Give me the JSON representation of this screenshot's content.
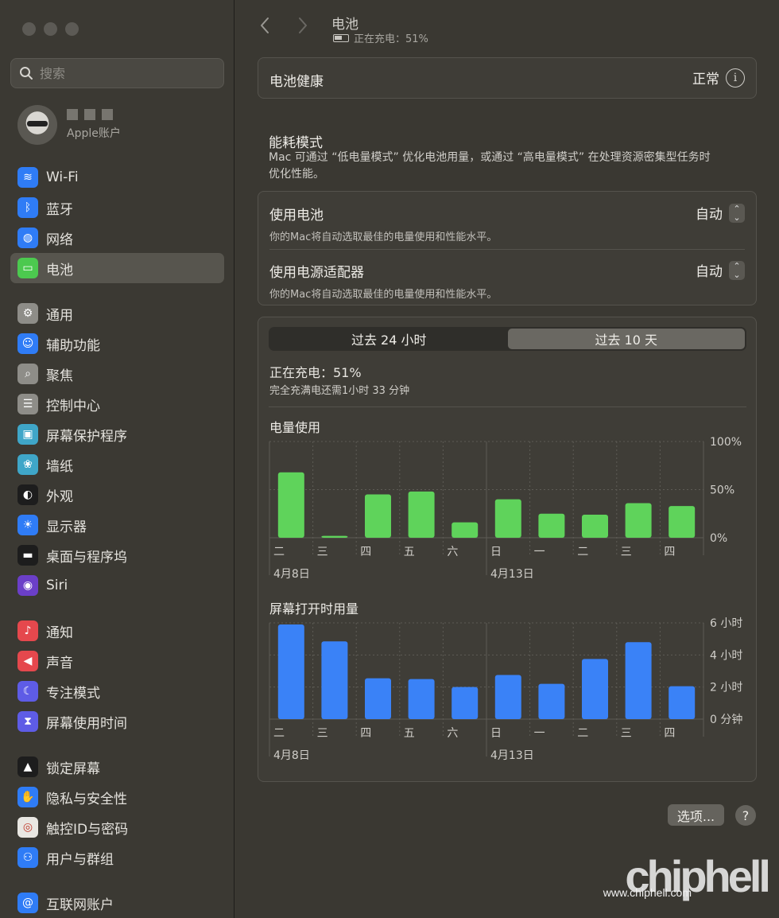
{
  "sidebar": {
    "search_placeholder": "搜索",
    "account": {
      "subtitle": "Apple账户"
    },
    "groups": [
      [
        {
          "label": "Wi-Fi",
          "icon": "wifi-icon",
          "color": "#2f7cf6",
          "glyph": "≋"
        },
        {
          "label": "蓝牙",
          "icon": "bluetooth-icon",
          "color": "#2f7cf6",
          "glyph": "ᛒ"
        },
        {
          "label": "网络",
          "icon": "globe-icon",
          "color": "#2f7cf6",
          "glyph": "◍"
        },
        {
          "label": "电池",
          "icon": "battery-icon",
          "color": "#4cc94f",
          "glyph": "▭",
          "active": true
        }
      ],
      [
        {
          "label": "通用",
          "icon": "gear-icon",
          "color": "#8e8d88",
          "glyph": "⚙"
        },
        {
          "label": "辅助功能",
          "icon": "accessibility-icon",
          "color": "#2f7cf6",
          "glyph": "☺"
        },
        {
          "label": "聚焦",
          "icon": "magnifier-icon",
          "color": "#8e8d88",
          "glyph": "⌕"
        },
        {
          "label": "控制中心",
          "icon": "control-center-icon",
          "color": "#8e8d88",
          "glyph": "☰"
        },
        {
          "label": "屏幕保护程序",
          "icon": "screensaver-icon",
          "color": "#3fa6c8",
          "glyph": "▣"
        },
        {
          "label": "墙纸",
          "icon": "wallpaper-icon",
          "color": "#3fa6c8",
          "glyph": "❀"
        },
        {
          "label": "外观",
          "icon": "appearance-icon",
          "color": "#1d1d1d",
          "glyph": "◐"
        },
        {
          "label": "显示器",
          "icon": "display-icon",
          "color": "#2f7cf6",
          "glyph": "☀"
        },
        {
          "label": "桌面与程序坞",
          "icon": "dock-icon",
          "color": "#1d1d1d",
          "glyph": "▬"
        },
        {
          "label": "Siri",
          "icon": "siri-icon",
          "color": "#6b3fc8",
          "glyph": "◉"
        }
      ],
      [
        {
          "label": "通知",
          "icon": "bell-icon",
          "color": "#e5484d",
          "glyph": "♪"
        },
        {
          "label": "声音",
          "icon": "speaker-icon",
          "color": "#e5484d",
          "glyph": "◀"
        },
        {
          "label": "专注模式",
          "icon": "moon-icon",
          "color": "#5e5ce6",
          "glyph": "☾"
        },
        {
          "label": "屏幕使用时间",
          "icon": "hourglass-icon",
          "color": "#5e5ce6",
          "glyph": "⧗"
        }
      ],
      [
        {
          "label": "锁定屏幕",
          "icon": "lock-icon",
          "color": "#1d1d1d",
          "glyph": "▲"
        },
        {
          "label": "隐私与安全性",
          "icon": "hand-icon",
          "color": "#2f7cf6",
          "glyph": "✋"
        },
        {
          "label": "触控ID与密码",
          "icon": "fingerprint-icon",
          "color": "#e9e7e2",
          "glyph": "◎"
        },
        {
          "label": "用户与群组",
          "icon": "users-icon",
          "color": "#2f7cf6",
          "glyph": "⚇"
        }
      ],
      [
        {
          "label": "互联网账户",
          "icon": "at-icon",
          "color": "#2f7cf6",
          "glyph": "@"
        }
      ]
    ]
  },
  "header": {
    "title": "电池",
    "status": "正在充电：51%"
  },
  "battery_health": {
    "label": "电池健康",
    "value": "正常"
  },
  "energy_mode": {
    "title": "能耗模式",
    "description": "Mac 可通过 “低电量模式” 优化电池用量，或通过 “高电量模式” 在处理资源密集型任务时优化性能。",
    "rows": [
      {
        "label": "使用电池",
        "desc": "你的Mac将自动选取最佳的电量使用和性能水平。",
        "value": "自动"
      },
      {
        "label": "使用电源适配器",
        "desc": "你的Mac将自动选取最佳的电量使用和性能水平。",
        "value": "自动"
      }
    ]
  },
  "usage": {
    "tabs": [
      "过去 24 小时",
      "过去 10 天"
    ],
    "active_tab": 1,
    "charging_title": "正在充电：51%",
    "charging_sub": "完全充满电还需1小时 33 分钟"
  },
  "chart_data": [
    {
      "type": "bar",
      "title": "电量使用",
      "categories": [
        "二",
        "三",
        "四",
        "五",
        "六",
        "日",
        "一",
        "二",
        "三",
        "四"
      ],
      "date_labels": [
        {
          "index": 0,
          "text": "4月8日"
        },
        {
          "index": 5,
          "text": "4月13日"
        }
      ],
      "values": [
        68,
        2,
        45,
        48,
        16,
        40,
        25,
        24,
        36,
        33
      ],
      "ylim": [
        0,
        100
      ],
      "yticks": [
        "100%",
        "50%",
        "0%"
      ],
      "color": "#5fd35b"
    },
    {
      "type": "bar",
      "title": "屏幕打开时用量",
      "categories": [
        "二",
        "三",
        "四",
        "五",
        "六",
        "日",
        "一",
        "二",
        "三",
        "四"
      ],
      "date_labels": [
        {
          "index": 0,
          "text": "4月8日"
        },
        {
          "index": 5,
          "text": "4月13日"
        }
      ],
      "values": [
        5.9,
        4.85,
        2.55,
        2.5,
        2.0,
        2.75,
        2.2,
        3.75,
        4.8,
        2.05
      ],
      "ylim": [
        0,
        6
      ],
      "yticks": [
        "6 小时",
        "4 小时",
        "2 小时",
        "0 分钟"
      ],
      "color": "#3a82f7"
    }
  ],
  "footer": {
    "options_label": "选项...",
    "help_label": "?"
  },
  "watermark": {
    "logo": "chiphell",
    "url": "www.chiphell.com"
  }
}
